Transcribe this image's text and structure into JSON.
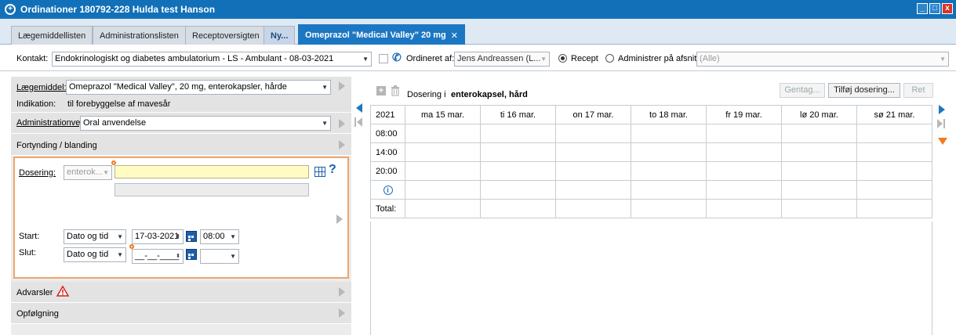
{
  "window": {
    "title": "Ordinationer 180792-228 Hulda test Hanson",
    "min_label": "_",
    "max_label": "□",
    "close_label": "x"
  },
  "tabs": [
    {
      "label": "Lægemiddellisten"
    },
    {
      "label": "Administrationslisten"
    },
    {
      "label": "Receptoversigten"
    },
    {
      "label": "Ny..."
    },
    {
      "label": "Omeprazol \"Medical Valley\" 20 mg",
      "close": "✕"
    }
  ],
  "contact": {
    "label": "Kontakt:",
    "value": "Endokrinologiskt og diabetes ambulatorium - LS - Ambulant -  08-03-2021",
    "ordered_by_label": "Ordineret af:",
    "ordered_by_value": "Jens Andreassen (L...",
    "recept_label": "Recept",
    "administer_label": "Administrer på afsnit:",
    "administer_value": "(Alle)"
  },
  "left": {
    "drug_label": "Lægemiddel:",
    "drug_value": "Omeprazol \"Medical Valley\", 20 mg, enterokapsler, hårde",
    "indication_label": "Indikation:",
    "indication_value": "til forebyggelse af mavesår",
    "admin_route_label": "Administrationvej",
    "admin_route_value": "Oral anvendelse",
    "dilution_label": "Fortynding / blanding",
    "dosage_label": "Dosering:",
    "dosage_unit": "enterok...",
    "dosage_value": "",
    "help_symbol": "?",
    "start_label": "Start:",
    "start_type": "Dato og tid",
    "start_date": "17-03-2021",
    "start_time": "08:00",
    "end_label": "Slut:",
    "end_type": "Dato og tid",
    "end_date": "__-__-____",
    "end_time": "",
    "warnings_label": "Advarsler",
    "followup_label": "Opfølgning"
  },
  "right": {
    "dosage_in_label": "Dosering i",
    "dosage_form": "enterokapsel, hård",
    "repeat_btn": "Gentag...",
    "add_dosage_btn": "Tilføj dosering...",
    "edit_btn": "Ret",
    "schedule": {
      "year": "2021",
      "days": [
        "ma 15 mar.",
        "ti 16 mar.",
        "on 17 mar.",
        "to 18 mar.",
        "fr 19 mar.",
        "lø 20 mar.",
        "sø 21 mar."
      ],
      "times": [
        "08:00",
        "14:00",
        "20:00"
      ],
      "info_symbol": "i",
      "total_label": "Total:"
    }
  },
  "colors": {
    "titlebar": "#1170b8",
    "active_tab": "#1c77c3",
    "nav_arrow": "#1c77c3",
    "down_arrow": "#f07a1e",
    "focus_border": "#f0a46a"
  }
}
